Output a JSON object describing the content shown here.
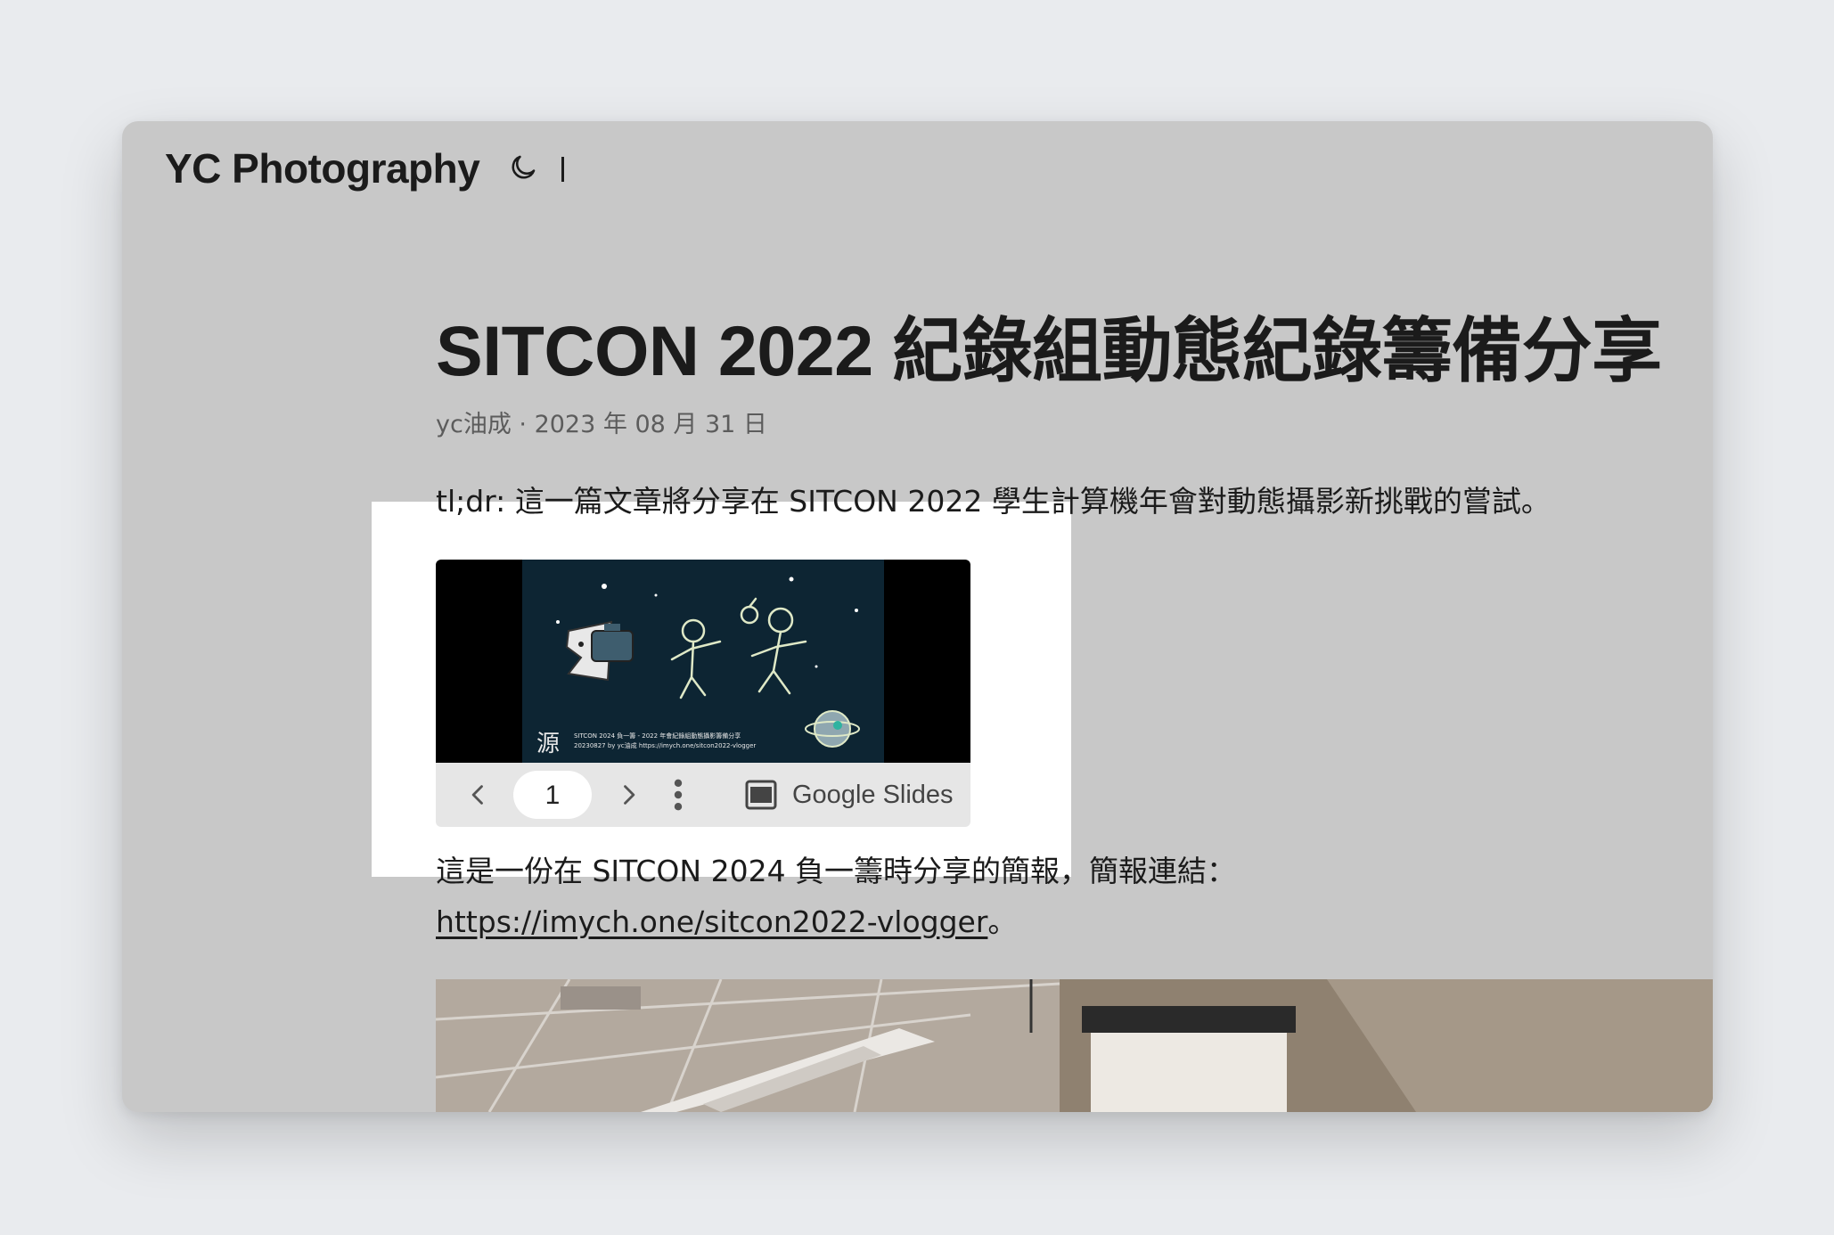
{
  "header": {
    "site_title": "YC Photography",
    "theme_toggle_icon": "moon-icon",
    "separator": "|"
  },
  "post": {
    "title": "SITCON 2022 紀錄組動態紀錄籌備分享",
    "author": "yc油成",
    "meta_sep": " · ",
    "date": "2023 年 08 月 31 日",
    "tldr": "tl;dr: 這一篇文章將分享在 SITCON 2022 學生計算機年會對動態攝影新挑戰的嘗試。",
    "paragraph": "這是一份在 SITCON 2024 負一籌時分享的簡報，簡報連結：",
    "link_text": "https://imych.one/sitcon2022-vlogger",
    "link_suffix": "。"
  },
  "slides_embed": {
    "thumbnail_caption_line1": "SITCON 2024 負一籌 - 2022 年會紀錄組動態攝影籌備分享",
    "thumbnail_caption_line2": "20230827 by yc油成 https://imych.one/sitcon2022-vlogger",
    "thumbnail_logo_char": "源",
    "current_page": "1",
    "brand_label": "Google Slides",
    "icons": [
      "chevron-left-icon",
      "chevron-right-icon",
      "more-vert-icon",
      "google-slides-icon"
    ]
  },
  "colors": {
    "page_bg": "#e9ebee",
    "window_bg": "#c8c8c8",
    "text": "#1b1b1b",
    "meta": "#5c5c5c",
    "slide_bg": "#0d2533",
    "highlight": "#ffffff"
  }
}
